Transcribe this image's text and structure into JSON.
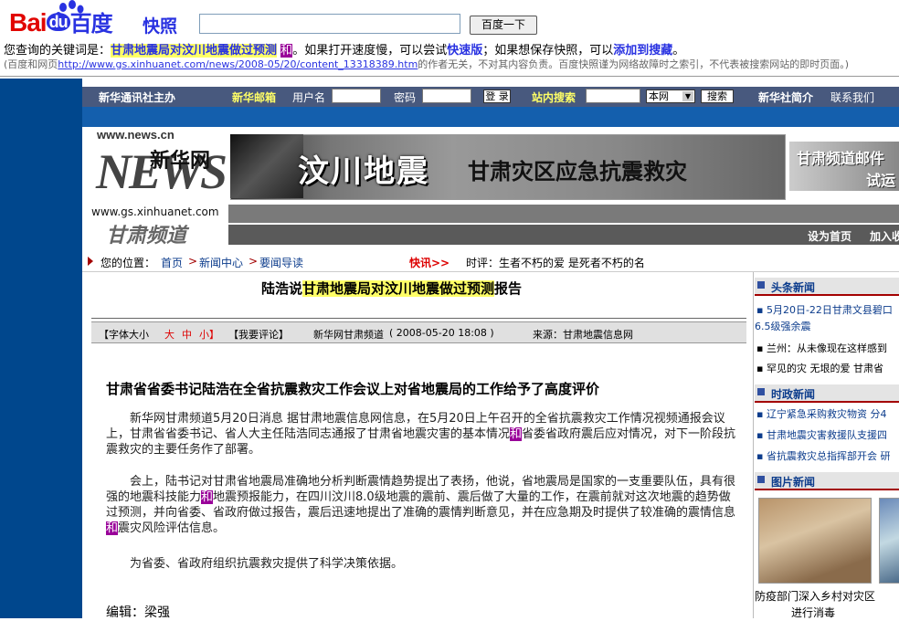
{
  "baidu": {
    "logo_text_bai": "Bai",
    "logo_text_du": "du",
    "logo_text_cn": "百度",
    "snapshot_label": "快照",
    "search_value": "",
    "search_button": "百度一下",
    "kw_prefix": "您查询的关键词是：",
    "kw_main": "甘肃地震局对汶川地震做过预测",
    "kw_he": "和",
    "kw_mid1": "。如果打开速度慢，可以尝试",
    "kw_fast": "快速版",
    "kw_mid2": "；如果想保存快照，可以",
    "kw_fav": "添加到搜藏",
    "kw_end": "。",
    "note_prefix": "(百度和网页",
    "note_url": "http://www.gs.xinhuanet.com/news/2008-05/20/content_13318389.htm",
    "note_suffix": "的作者无关，不对其内容负责。百度快照谨为网络故障时之索引，不代表被搜索网站的即时页面。)"
  },
  "nav": {
    "org": "新华通讯社主办",
    "mail": "新华邮箱",
    "user_label": "用户名",
    "pass_label": "密码",
    "login_btn": "登 录",
    "site_search": "站内搜索",
    "scope": "本网",
    "search_btn": "搜索",
    "intro": "新华社简介",
    "contact": "联系我们"
  },
  "logo": {
    "url1": "www.news.cn",
    "brand": "新华网",
    "news": "NEWS",
    "url2": "www.gs.xinhuanet.com",
    "channel": "甘肃频道"
  },
  "banner": {
    "title": "汶川地震",
    "subtitle": "甘肃灾区应急抗震救灾",
    "right_line1": "甘肃频道邮件",
    "right_line2": "试运"
  },
  "graybar": {
    "set_home": "设为首页",
    "add_fav": "加入收"
  },
  "crumb": {
    "location": "您的位置：",
    "home": "首页",
    "news_center": "新闻中心",
    "guide": "要闻导读",
    "flash": "快讯>>",
    "ticker": "时评：生者不朽的爱 是死者不朽的名"
  },
  "article": {
    "title_prefix": "陆浩说",
    "title_hl": "甘肃地震局对汶川地震做过预测",
    "title_suffix": "报告",
    "font_label": "【字体大小",
    "font_big": "大",
    "font_mid": "中",
    "font_small": "小】",
    "comment": "【我要评论】",
    "source_channel": "新华网甘肃频道",
    "date": "( 2008-05-20 18:08 )",
    "source": "来源：甘肃地震信息网",
    "subhead": "甘肃省省委书记陆浩在全省抗震救灾工作会议上对省地震局的工作给予了高度评价",
    "p1a": "　　新华网甘肃频道5月20日消息 据甘肃地震信息网信息，在5月20日上午召开的全省抗震救灾工作情况视频通报会议上，甘肃省省委书记、省人大主任陆浩同志通报了甘肃省地震灾害的基本情况",
    "p1he": "和",
    "p1b": "省委省政府震后应对情况，对下一阶段抗震救灾的主要任务作了部署。",
    "p2a": "　　会上，陆书记对甘肃省地震局准确地分析判断震情趋势提出了表扬，他说，省地震局是国家的一支重要队伍，具有很强的地震科技能力",
    "p2he1": "和",
    "p2b": "地震预报能力，在四川汶川8.0级地震的震前、震后做了大量的工作，在震前就对这次地震的趋势做过预测，并向省委、省政府做过报告，震后迅速地提出了准确的震情判断意见，并在应急期及时提供了较准确的震情信息",
    "p2he2": "和",
    "p2c": "震灾风险评估信息。",
    "p3": "　　为省委、省政府组织抗震救灾提供了科学决策依据。",
    "editor": "编辑：梁强"
  },
  "right": {
    "head1": "头条新闻",
    "h1_item1": "5月20日-22日甘肃文县碧口",
    "h1_item1b": "6.5级强余震",
    "h1_item2": "兰州：从未像现在这样感到",
    "h1_item3": "罕见的灾 无垠的爱 甘肃省",
    "head2": "时政新闻",
    "h2_item1": "辽宁紧急采购救灾物资 分4",
    "h2_item2": "甘肃地震灾害救援队支援四",
    "h2_item3": "省抗震救灾总指挥部开会 研",
    "head3": "图片新闻",
    "cap1": "防疫部门深入乡村对灾区",
    "cap2": "进行消毒"
  }
}
